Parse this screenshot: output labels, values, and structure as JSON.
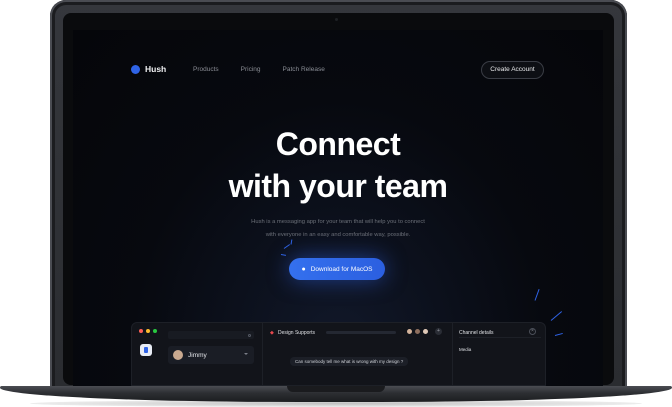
{
  "brand": {
    "name": "Hush",
    "accent": "#2f63e6"
  },
  "nav": {
    "links": [
      "Products",
      "Pricing",
      "Patch Release"
    ],
    "cta": "Create Account"
  },
  "hero": {
    "title_line1": "Connect",
    "title_line2": "with your team",
    "subtitle_line1": "Hush is a messaging app for your team that will help you to connect",
    "subtitle_line2": "with everyone in an easy and comfortable way, possible.",
    "download_label": "Download for MacOS",
    "download_icon": "apple-icon"
  },
  "app_preview": {
    "contact_name": "Jimmy",
    "channel_name": "Design Supports",
    "message": "Can somebody tell me what is wrong with my design ?",
    "details_title": "Channel details",
    "details_media": "Media"
  }
}
